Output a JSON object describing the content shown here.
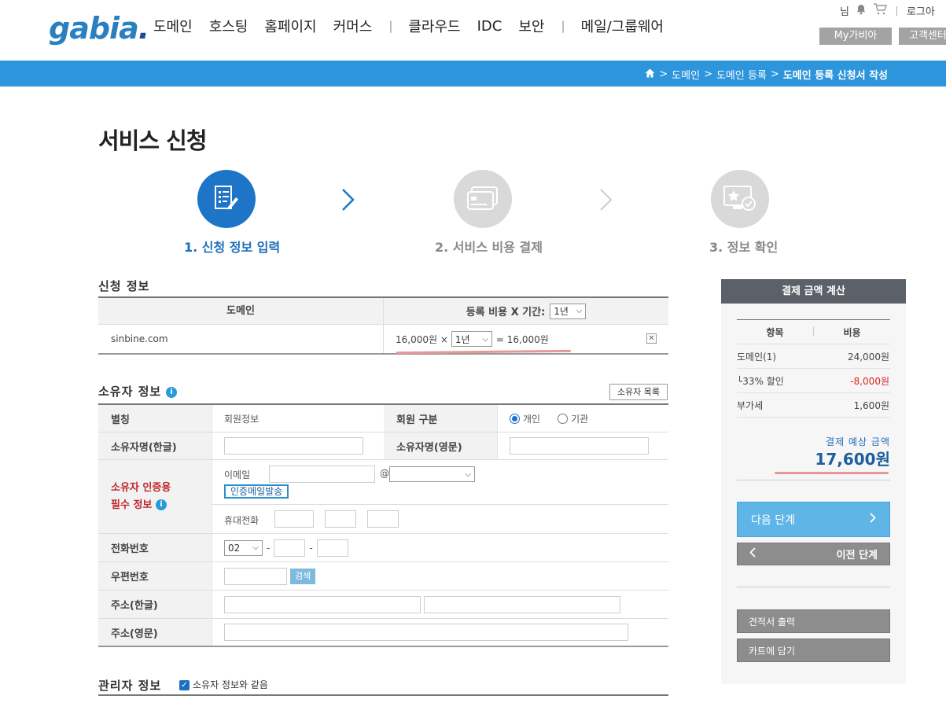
{
  "header": {
    "logo_text": "gabia",
    "logo_dot": ".",
    "nav": [
      "도메인",
      "호스팅",
      "홈페이지",
      "커머스",
      "|",
      "클라우드",
      "IDC",
      "보안",
      "|",
      "메일/그룹웨어"
    ],
    "util_user": "님",
    "util_login": "로그아",
    "my_button": "My가비아",
    "cs_button": "고객센터"
  },
  "breadcrumb": {
    "items": [
      "도메인",
      "도메인 등록"
    ],
    "current": "도메인 등록 신청서 작성"
  },
  "page_title": "서비스 신청",
  "steps": [
    {
      "label": "1. 신청 정보 입력",
      "state": "active"
    },
    {
      "label": "2. 서비스 비용 결제",
      "state": "inactive"
    },
    {
      "label": "3. 정보 확인",
      "state": "inactive"
    }
  ],
  "application": {
    "section_title": "신청 정보",
    "col_domain": "도메인",
    "col_fee": "등록 비용 X 기간:",
    "period_select": "1년",
    "domain": "sinbine.com",
    "unit_price": "16,000원 ×",
    "row_period": "1년",
    "row_total": "= 16,000원",
    "remove_icon": "close-icon"
  },
  "owner": {
    "section_title": "소유자 정보",
    "list_button": "소유자 목록",
    "rows": {
      "alias_label": "별칭",
      "alias_value": "회원정보",
      "member_type_label": "회원 구분",
      "member_type_options": [
        "개인",
        "기관"
      ],
      "member_type_selected": "개인",
      "name_kr_label": "소유자명(한글)",
      "name_en_label": "소유자명(영문)",
      "verify_label_1": "소유자 인증용",
      "verify_label_2": "필수 정보",
      "email_label": "이메일",
      "email_at": "@",
      "email_domain_select": "",
      "verify_button": "인증메일발송",
      "mobile_label": "휴대전화",
      "phone_label": "전화번호",
      "phone_area": "02",
      "dash": "-",
      "zip_label": "우편번호",
      "zip_search": "검색",
      "addr_kr_label": "주소(한글)",
      "addr_en_label": "주소(영문)"
    }
  },
  "admin": {
    "section_title": "관리자 정보",
    "same_as_owner": "소유자 정보와 같음",
    "same_checked": true
  },
  "payment": {
    "title": "결제 금액 계산",
    "col_item": "항목",
    "col_cost": "비용",
    "rows": [
      {
        "item": "도메인(1)",
        "cost": "24,000원",
        "negative": false
      },
      {
        "item": "└33% 할인",
        "cost": "-8,000원",
        "negative": true
      },
      {
        "item": "부가세",
        "cost": "1,600원",
        "negative": false
      }
    ],
    "estimate_label": "결제 예상 금액",
    "estimate_value": "17,600원",
    "next_button": "다음 단계",
    "prev_button": "이전 단계",
    "quote_button": "견적서 출력",
    "cart_button": "카트에 담기"
  },
  "colors": {
    "brand_blue": "#2d95db",
    "step_active": "#1e75c7",
    "next_button": "#5fb5e6",
    "panel_head": "#5c6068",
    "discount_red": "#dd2222"
  }
}
